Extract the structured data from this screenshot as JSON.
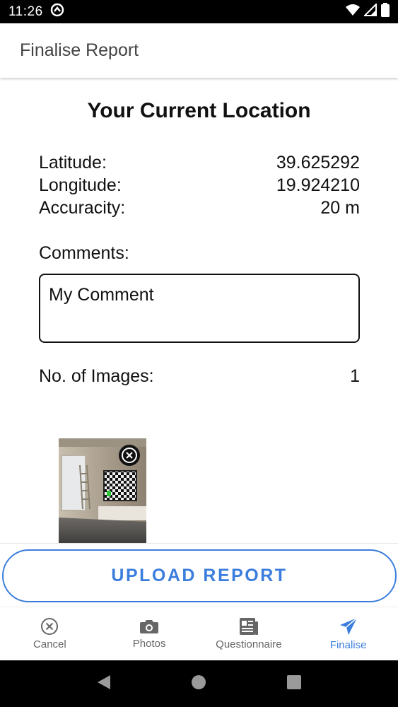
{
  "status_bar": {
    "time": "11:26"
  },
  "app_bar": {
    "title": "Finalise Report"
  },
  "location": {
    "heading": "Your Current Location",
    "rows": [
      {
        "label": "Latitude:",
        "value": "39.625292"
      },
      {
        "label": "Longitude:",
        "value": "19.924210"
      },
      {
        "label": "Accuracity:",
        "value": "20 m"
      }
    ]
  },
  "comments": {
    "label": "Comments:",
    "value": "My Comment"
  },
  "images": {
    "label": "No. of Images:",
    "count": "1"
  },
  "upload": {
    "label": "UPLOAD REPORT"
  },
  "bottom_nav": {
    "items": [
      {
        "label": "Cancel",
        "icon": "cancel-icon"
      },
      {
        "label": "Photos",
        "icon": "camera-icon"
      },
      {
        "label": "Questionnaire",
        "icon": "newspaper-icon"
      },
      {
        "label": "Finalise",
        "icon": "send-icon",
        "active": true
      }
    ]
  },
  "colors": {
    "accent": "#3b7ddd",
    "text": "#111111",
    "muted": "#666666"
  }
}
